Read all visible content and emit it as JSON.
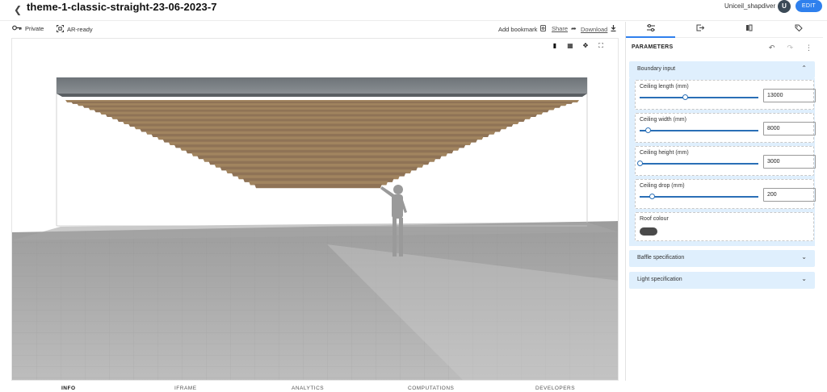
{
  "header": {
    "title": "theme-1-classic-straight-23-06-2023-7",
    "user_name": "Uniceil_shapdiver",
    "avatar_initial": "U",
    "edit_label": "EDIT"
  },
  "toolbar": {
    "private_label": "Private",
    "ar_label": "AR-ready",
    "bookmark_label": "Add bookmark",
    "share_label": "Share",
    "download_label": "Download"
  },
  "panel": {
    "title": "PARAMETERS",
    "sections": [
      {
        "label": "Boundary input",
        "expanded": true
      },
      {
        "label": "Baffle specification",
        "expanded": false
      },
      {
        "label": "Light specification",
        "expanded": false
      }
    ],
    "params": [
      {
        "label": "Ceiling length (mm)",
        "value": "13000",
        "slider_fraction": 0.38
      },
      {
        "label": "Ceiling width (mm)",
        "value": "8000",
        "slider_fraction": 0.07
      },
      {
        "label": "Ceiling height (mm)",
        "value": "3000",
        "slider_fraction": 0.0
      },
      {
        "label": "Ceiling drop (mm)",
        "value": "200",
        "slider_fraction": 0.1
      }
    ],
    "roof": {
      "label": "Roof colour",
      "color": "#4a4a4a"
    }
  },
  "bottom_tabs": [
    "INFO",
    "IFRAME",
    "ANALYTICS",
    "COMPUTATIONS",
    "DEVELOPERS"
  ],
  "colors": {
    "accent": "#2f80ed",
    "section_bg": "#dfeffd",
    "slider": "#2a6fb6"
  }
}
